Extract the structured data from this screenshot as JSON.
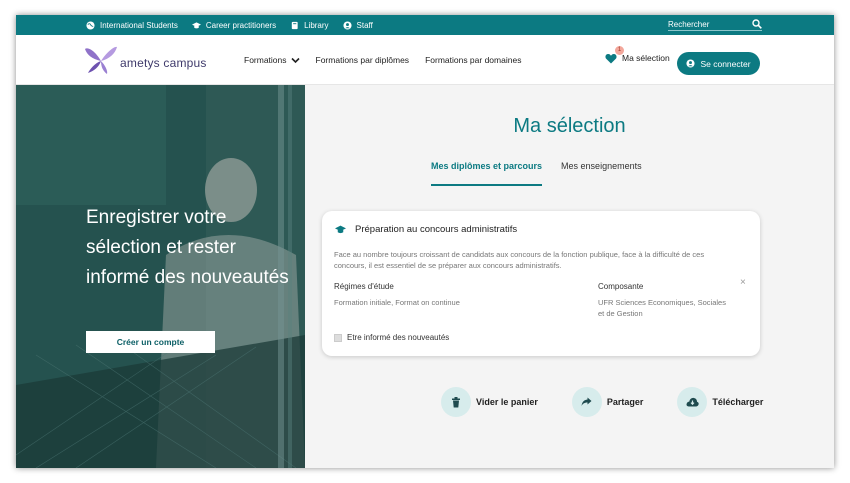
{
  "topbar": {
    "links": [
      {
        "label": "International Students",
        "icon": "globe-icon"
      },
      {
        "label": "Career practitioners",
        "icon": "graduation-cap-icon"
      },
      {
        "label": "Library",
        "icon": "book-icon"
      },
      {
        "label": "Staff",
        "icon": "user-icon"
      }
    ],
    "search_placeholder": "Rechercher"
  },
  "header": {
    "brand": "ametys campus",
    "nav": [
      "Formations",
      "Formations par diplômes",
      "Formations par domaines"
    ],
    "selection_label": "Ma sélection",
    "selection_count": "1",
    "login_label": "Se connecter"
  },
  "hero": {
    "text": "Enregistrer votre sélection et rester informé des nouveautés",
    "button": "Créer un compte"
  },
  "main": {
    "title": "Ma sélection",
    "tabs": [
      "Mes diplômes et parcours",
      "Mes enseignements"
    ],
    "card": {
      "title": "Préparation au concours administratifs",
      "description": "Face au nombre toujours croissant de candidats aux concours de la fonction publique, face à la difficulté de ces concours, il est essentiel de se préparer aux concours administratifs.",
      "col1_label": "Régimes d'étude",
      "col1_value": "Formation initiale, Format on continue",
      "col2_label": "Composante",
      "col2_value": "UFR Sciences Economiques, Sociales et de Gestion",
      "checkbox_label": "Etre informé des nouveautés",
      "close": "×"
    },
    "actions": [
      {
        "label": "Vider le panier",
        "icon": "trash-icon"
      },
      {
        "label": "Partager",
        "icon": "share-icon"
      },
      {
        "label": "Télécharger",
        "icon": "download-icon"
      }
    ]
  },
  "colors": {
    "accent": "#0c7a82",
    "badge": "#f3a79b"
  }
}
